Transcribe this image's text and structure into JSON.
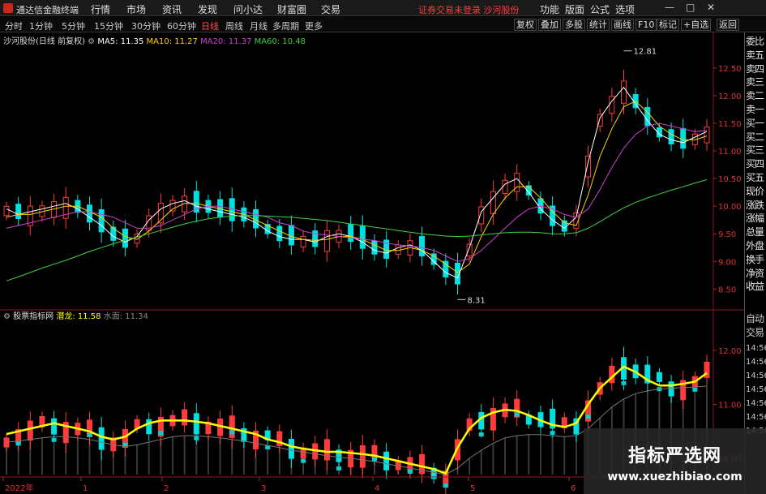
{
  "titlebar": {
    "app_title": "通达信金融终端",
    "menus": [
      "行情",
      "市场",
      "资讯",
      "发现",
      "问小达",
      "财富圈",
      "交易"
    ],
    "notice": "证券交易未登录  沙河股份",
    "right_menus": [
      "功能",
      "版面",
      "公式",
      "选项"
    ],
    "window_buttons": [
      "—",
      "□",
      "✕"
    ]
  },
  "toolbar": {
    "periods": [
      "分时",
      "1分钟",
      "5分钟",
      "15分钟",
      "30分钟",
      "60分钟",
      "日线",
      "周线",
      "月线",
      "多周期",
      "更多"
    ],
    "active_period": "日线",
    "buttons": [
      "复权",
      "叠加",
      "多股",
      "统计",
      "画线",
      "F10",
      "标记",
      "+自选",
      "返回"
    ]
  },
  "main_chart": {
    "title": "沙河股份(日线 前复权)",
    "indicators": [
      {
        "label": "MA5: 11.35",
        "color": "#ffffff"
      },
      {
        "label": "MA10: 11.27",
        "color": "#ffd400"
      },
      {
        "label": "MA20: 11.37",
        "color": "#d040d0"
      },
      {
        "label": "MA60: 10.48",
        "color": "#40d040"
      }
    ]
  },
  "sub_chart": {
    "title": "股票指标网",
    "indicators": [
      {
        "label": "潜龙: 11.58",
        "color": "#ffff00"
      },
      {
        "label": "水面: 11.34",
        "color": "#888888"
      }
    ]
  },
  "sidebar": {
    "items": [
      "委比",
      "卖五",
      "卖四",
      "卖三",
      "卖二",
      "卖一",
      "买一",
      "买二",
      "买三",
      "买四",
      "买五",
      "现价",
      "涨跌",
      "涨幅",
      "总量",
      "外盘",
      "换手",
      "净资",
      "收益"
    ],
    "auto_items": [
      "自动",
      "交易"
    ],
    "times": [
      "14:56",
      "14:56",
      "14:56",
      "14:56",
      "14:56",
      "14:56",
      "14:56"
    ]
  },
  "watermark": {
    "title": "指标严选网",
    "url": "www.xuezhibiao.com"
  },
  "chart_data": {
    "type": "candlestick",
    "title": "沙河股份(日线 前复权)",
    "xlabel": "",
    "ylabel": "",
    "ylim": [
      8.3,
      12.85
    ],
    "yticks": [
      "12.50",
      "12.00",
      "11.50",
      "11.00",
      "10.50",
      "10.00",
      "9.50",
      "9.00",
      "8.50"
    ],
    "sub_ylim": [
      9.7,
      12.6
    ],
    "sub_yticks": [
      "12.00",
      "11.00",
      "10.00"
    ],
    "x_labels": [
      "2022年",
      "1",
      "2",
      "3",
      "4",
      "5",
      "6"
    ],
    "annotations": [
      {
        "label": "12.81",
        "value": 12.81
      },
      {
        "label": "8.31",
        "value": 8.31
      }
    ],
    "series": [
      {
        "name": "MA5",
        "color": "#ffffff",
        "values": [
          9.95,
          9.85,
          9.9,
          9.95,
          10.0,
          10.05,
          9.95,
          9.8,
          9.65,
          9.45,
          9.35,
          9.45,
          9.75,
          9.95,
          10.05,
          10.1,
          10.0,
          9.95,
          9.9,
          9.85,
          9.8,
          9.7,
          9.55,
          9.45,
          9.4,
          9.4,
          9.35,
          9.45,
          9.5,
          9.45,
          9.35,
          9.2,
          9.15,
          9.25,
          9.3,
          9.2,
          9.0,
          8.8,
          8.7,
          9.25,
          9.9,
          10.15,
          10.4,
          10.5,
          10.25,
          9.95,
          9.75,
          9.6,
          9.8,
          10.8,
          11.6,
          11.9,
          12.15,
          11.85,
          11.55,
          11.3,
          11.2,
          11.15,
          11.25,
          11.35
        ]
      },
      {
        "name": "MA10",
        "color": "#ffd400",
        "values": [
          9.8,
          9.85,
          9.85,
          9.9,
          9.95,
          10.0,
          10.0,
          9.9,
          9.8,
          9.6,
          9.45,
          9.4,
          9.55,
          9.75,
          9.95,
          10.05,
          10.05,
          10.0,
          9.95,
          9.9,
          9.85,
          9.75,
          9.65,
          9.55,
          9.45,
          9.4,
          9.38,
          9.4,
          9.45,
          9.45,
          9.4,
          9.3,
          9.2,
          9.2,
          9.25,
          9.2,
          9.1,
          8.95,
          8.8,
          8.95,
          9.45,
          9.85,
          10.15,
          10.35,
          10.35,
          10.15,
          9.9,
          9.7,
          9.65,
          10.2,
          10.9,
          11.4,
          11.8,
          11.9,
          11.7,
          11.45,
          11.3,
          11.2,
          11.2,
          11.27
        ]
      },
      {
        "name": "MA20",
        "color": "#d040d0",
        "values": [
          9.6,
          9.65,
          9.7,
          9.75,
          9.8,
          9.85,
          9.9,
          9.9,
          9.85,
          9.8,
          9.7,
          9.6,
          9.6,
          9.65,
          9.75,
          9.85,
          9.95,
          10.0,
          10.0,
          9.95,
          9.9,
          9.85,
          9.8,
          9.7,
          9.65,
          9.55,
          9.5,
          9.48,
          9.45,
          9.43,
          9.4,
          9.38,
          9.33,
          9.3,
          9.28,
          9.25,
          9.2,
          9.1,
          9.0,
          9.05,
          9.2,
          9.4,
          9.6,
          9.8,
          9.95,
          10.0,
          9.95,
          9.85,
          9.8,
          9.95,
          10.3,
          10.7,
          11.05,
          11.3,
          11.45,
          11.5,
          11.45,
          11.4,
          11.35,
          11.37
        ]
      },
      {
        "name": "MA60",
        "color": "#40d040",
        "values": [
          8.65,
          8.72,
          8.8,
          8.88,
          8.95,
          9.02,
          9.1,
          9.18,
          9.25,
          9.32,
          9.38,
          9.44,
          9.5,
          9.56,
          9.62,
          9.68,
          9.73,
          9.77,
          9.8,
          9.82,
          9.83,
          9.83,
          9.82,
          9.81,
          9.8,
          9.78,
          9.76,
          9.74,
          9.71,
          9.68,
          9.65,
          9.62,
          9.59,
          9.56,
          9.53,
          9.5,
          9.48,
          9.46,
          9.45,
          9.46,
          9.48,
          9.5,
          9.52,
          9.53,
          9.53,
          9.52,
          9.5,
          9.5,
          9.52,
          9.6,
          9.72,
          9.85,
          9.97,
          10.07,
          10.15,
          10.22,
          10.29,
          10.35,
          10.42,
          10.48
        ]
      }
    ],
    "sub_series": [
      {
        "name": "潜龙",
        "color": "#ffff00",
        "values": [
          10.45,
          10.5,
          10.55,
          10.6,
          10.65,
          10.6,
          10.55,
          10.5,
          10.4,
          10.35,
          10.4,
          10.55,
          10.65,
          10.7,
          10.7,
          10.7,
          10.68,
          10.65,
          10.6,
          10.55,
          10.5,
          10.45,
          10.35,
          10.3,
          10.22,
          10.18,
          10.15,
          10.12,
          10.12,
          10.1,
          10.08,
          10.05,
          10.0,
          9.95,
          9.9,
          9.85,
          9.8,
          9.72,
          10.2,
          10.55,
          10.75,
          10.85,
          10.9,
          10.88,
          10.8,
          10.7,
          10.62,
          10.58,
          10.65,
          11.0,
          11.3,
          11.5,
          11.7,
          11.6,
          11.45,
          11.35,
          11.35,
          11.38,
          11.42,
          11.58
        ]
      },
      {
        "name": "水面",
        "color": "#777777",
        "values": [
          10.3,
          10.32,
          10.35,
          10.38,
          10.4,
          10.4,
          10.38,
          10.35,
          10.3,
          10.25,
          10.22,
          10.25,
          10.3,
          10.35,
          10.4,
          10.42,
          10.42,
          10.4,
          10.38,
          10.35,
          10.32,
          10.28,
          10.24,
          10.2,
          10.15,
          10.12,
          10.08,
          10.05,
          10.02,
          10.0,
          9.97,
          9.94,
          9.9,
          9.86,
          9.82,
          9.78,
          9.74,
          9.7,
          9.82,
          10.0,
          10.15,
          10.28,
          10.38,
          10.42,
          10.44,
          10.44,
          10.42,
          10.4,
          10.42,
          10.55,
          10.75,
          10.95,
          11.1,
          11.2,
          11.25,
          11.28,
          11.3,
          11.31,
          11.32,
          11.34
        ]
      }
    ]
  }
}
